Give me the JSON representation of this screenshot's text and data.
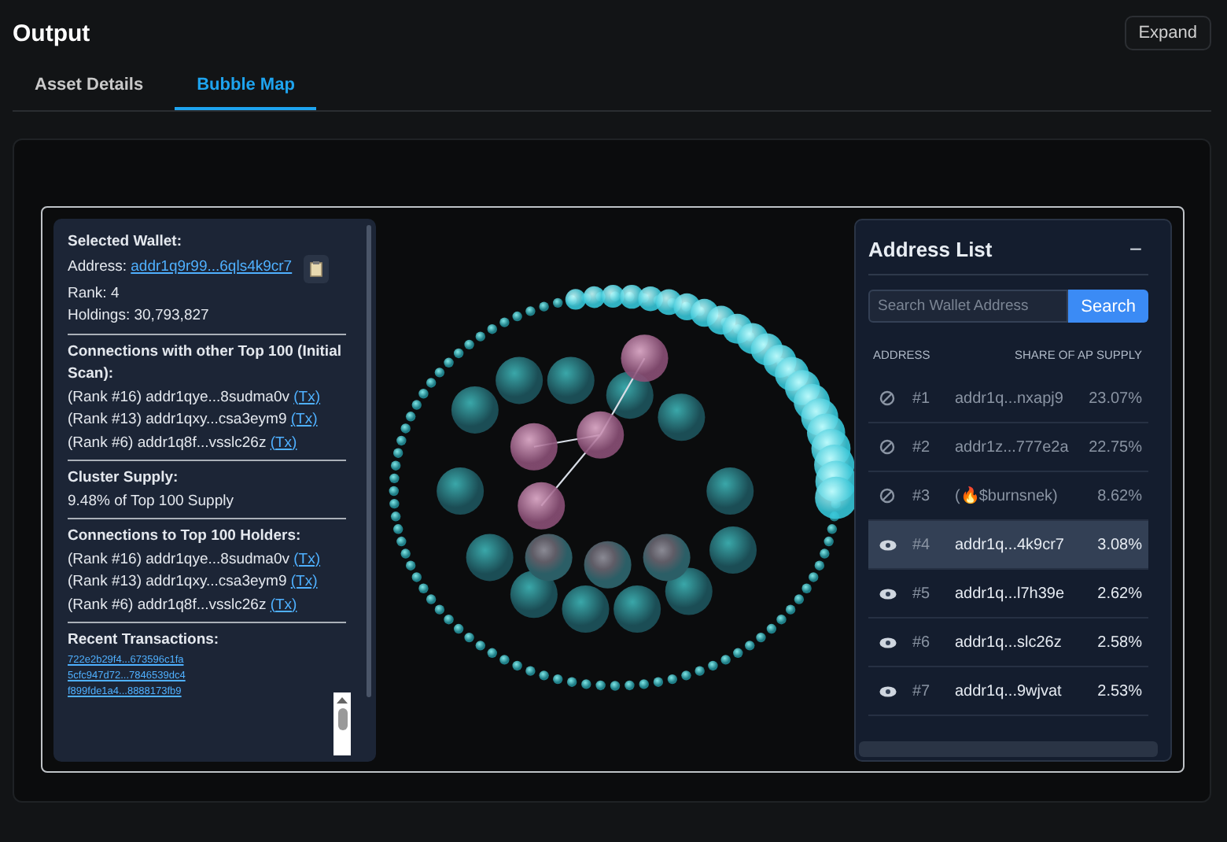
{
  "header": {
    "title": "Output",
    "expand_button": "Expand"
  },
  "tabs": [
    {
      "label": "Asset Details",
      "selected": false
    },
    {
      "label": "Bubble Map",
      "selected": true
    }
  ],
  "wallet_panel": {
    "title": "Selected Wallet:",
    "address_label": "Address:",
    "address": "addr1q9r99...6qls4k9cr7",
    "rank": "Rank: 4",
    "holdings": "Holdings: 30,793,827",
    "sections": [
      {
        "title": "Connections with other Top 100 (Initial Scan):",
        "kind": "links",
        "lines": [
          {
            "text": "(Rank #16) addr1qye...8sudma0v",
            "link": "(Tx)"
          },
          {
            "text": "(Rank #13) addr1qxy...csa3eym9",
            "link": "(Tx)"
          },
          {
            "text": "(Rank #6) addr1q8f...vsslc26z",
            "link": "(Tx)"
          }
        ]
      },
      {
        "title": "Cluster Supply:",
        "kind": "plain",
        "lines": [
          {
            "text": "9.48% of Top 100 Supply"
          }
        ]
      },
      {
        "title": "Connections to Top 100 Holders:",
        "kind": "links",
        "lines": [
          {
            "text": "(Rank #16) addr1qye...8sudma0v",
            "link": "(Tx)"
          },
          {
            "text": "(Rank #13) addr1qxy...csa3eym9",
            "link": "(Tx)"
          },
          {
            "text": "(Rank #6) addr1q8f...vsslc26z",
            "link": "(Tx)"
          }
        ]
      }
    ],
    "transactions_title": "Recent Transactions:",
    "transactions": [
      "722e2b29f4...673596c1fa",
      "5cfc947d72...7846539dc4",
      "f899fde1a4...8888173fb9"
    ]
  },
  "address_list": {
    "title": "Address List",
    "collapse": "−",
    "search_placeholder": "Search Wallet Address",
    "search_button": "Search",
    "columns": [
      "ADDRESS",
      "SHARE OF AP SUPPLY"
    ],
    "rows": [
      {
        "rank": "#1",
        "address": "addr1q...nxapj9",
        "share": "23.07%",
        "hidden": true,
        "selected": false
      },
      {
        "rank": "#2",
        "address": "addr1z...777e2a",
        "share": "22.75%",
        "hidden": true,
        "selected": false
      },
      {
        "rank": "#3",
        "address": "(🔥$burnsnek)",
        "share": "8.62%",
        "hidden": true,
        "selected": false
      },
      {
        "rank": "#4",
        "address": "addr1q...4k9cr7",
        "share": "3.08%",
        "hidden": false,
        "selected": true
      },
      {
        "rank": "#5",
        "address": "addr1q...l7h39e",
        "share": "2.62%",
        "hidden": false,
        "selected": false
      },
      {
        "rank": "#6",
        "address": "addr1q...slc26z",
        "share": "2.58%",
        "hidden": false,
        "selected": false
      },
      {
        "rank": "#7",
        "address": "addr1q...9wjvat",
        "share": "2.53%",
        "hidden": false,
        "selected": false
      }
    ]
  }
}
